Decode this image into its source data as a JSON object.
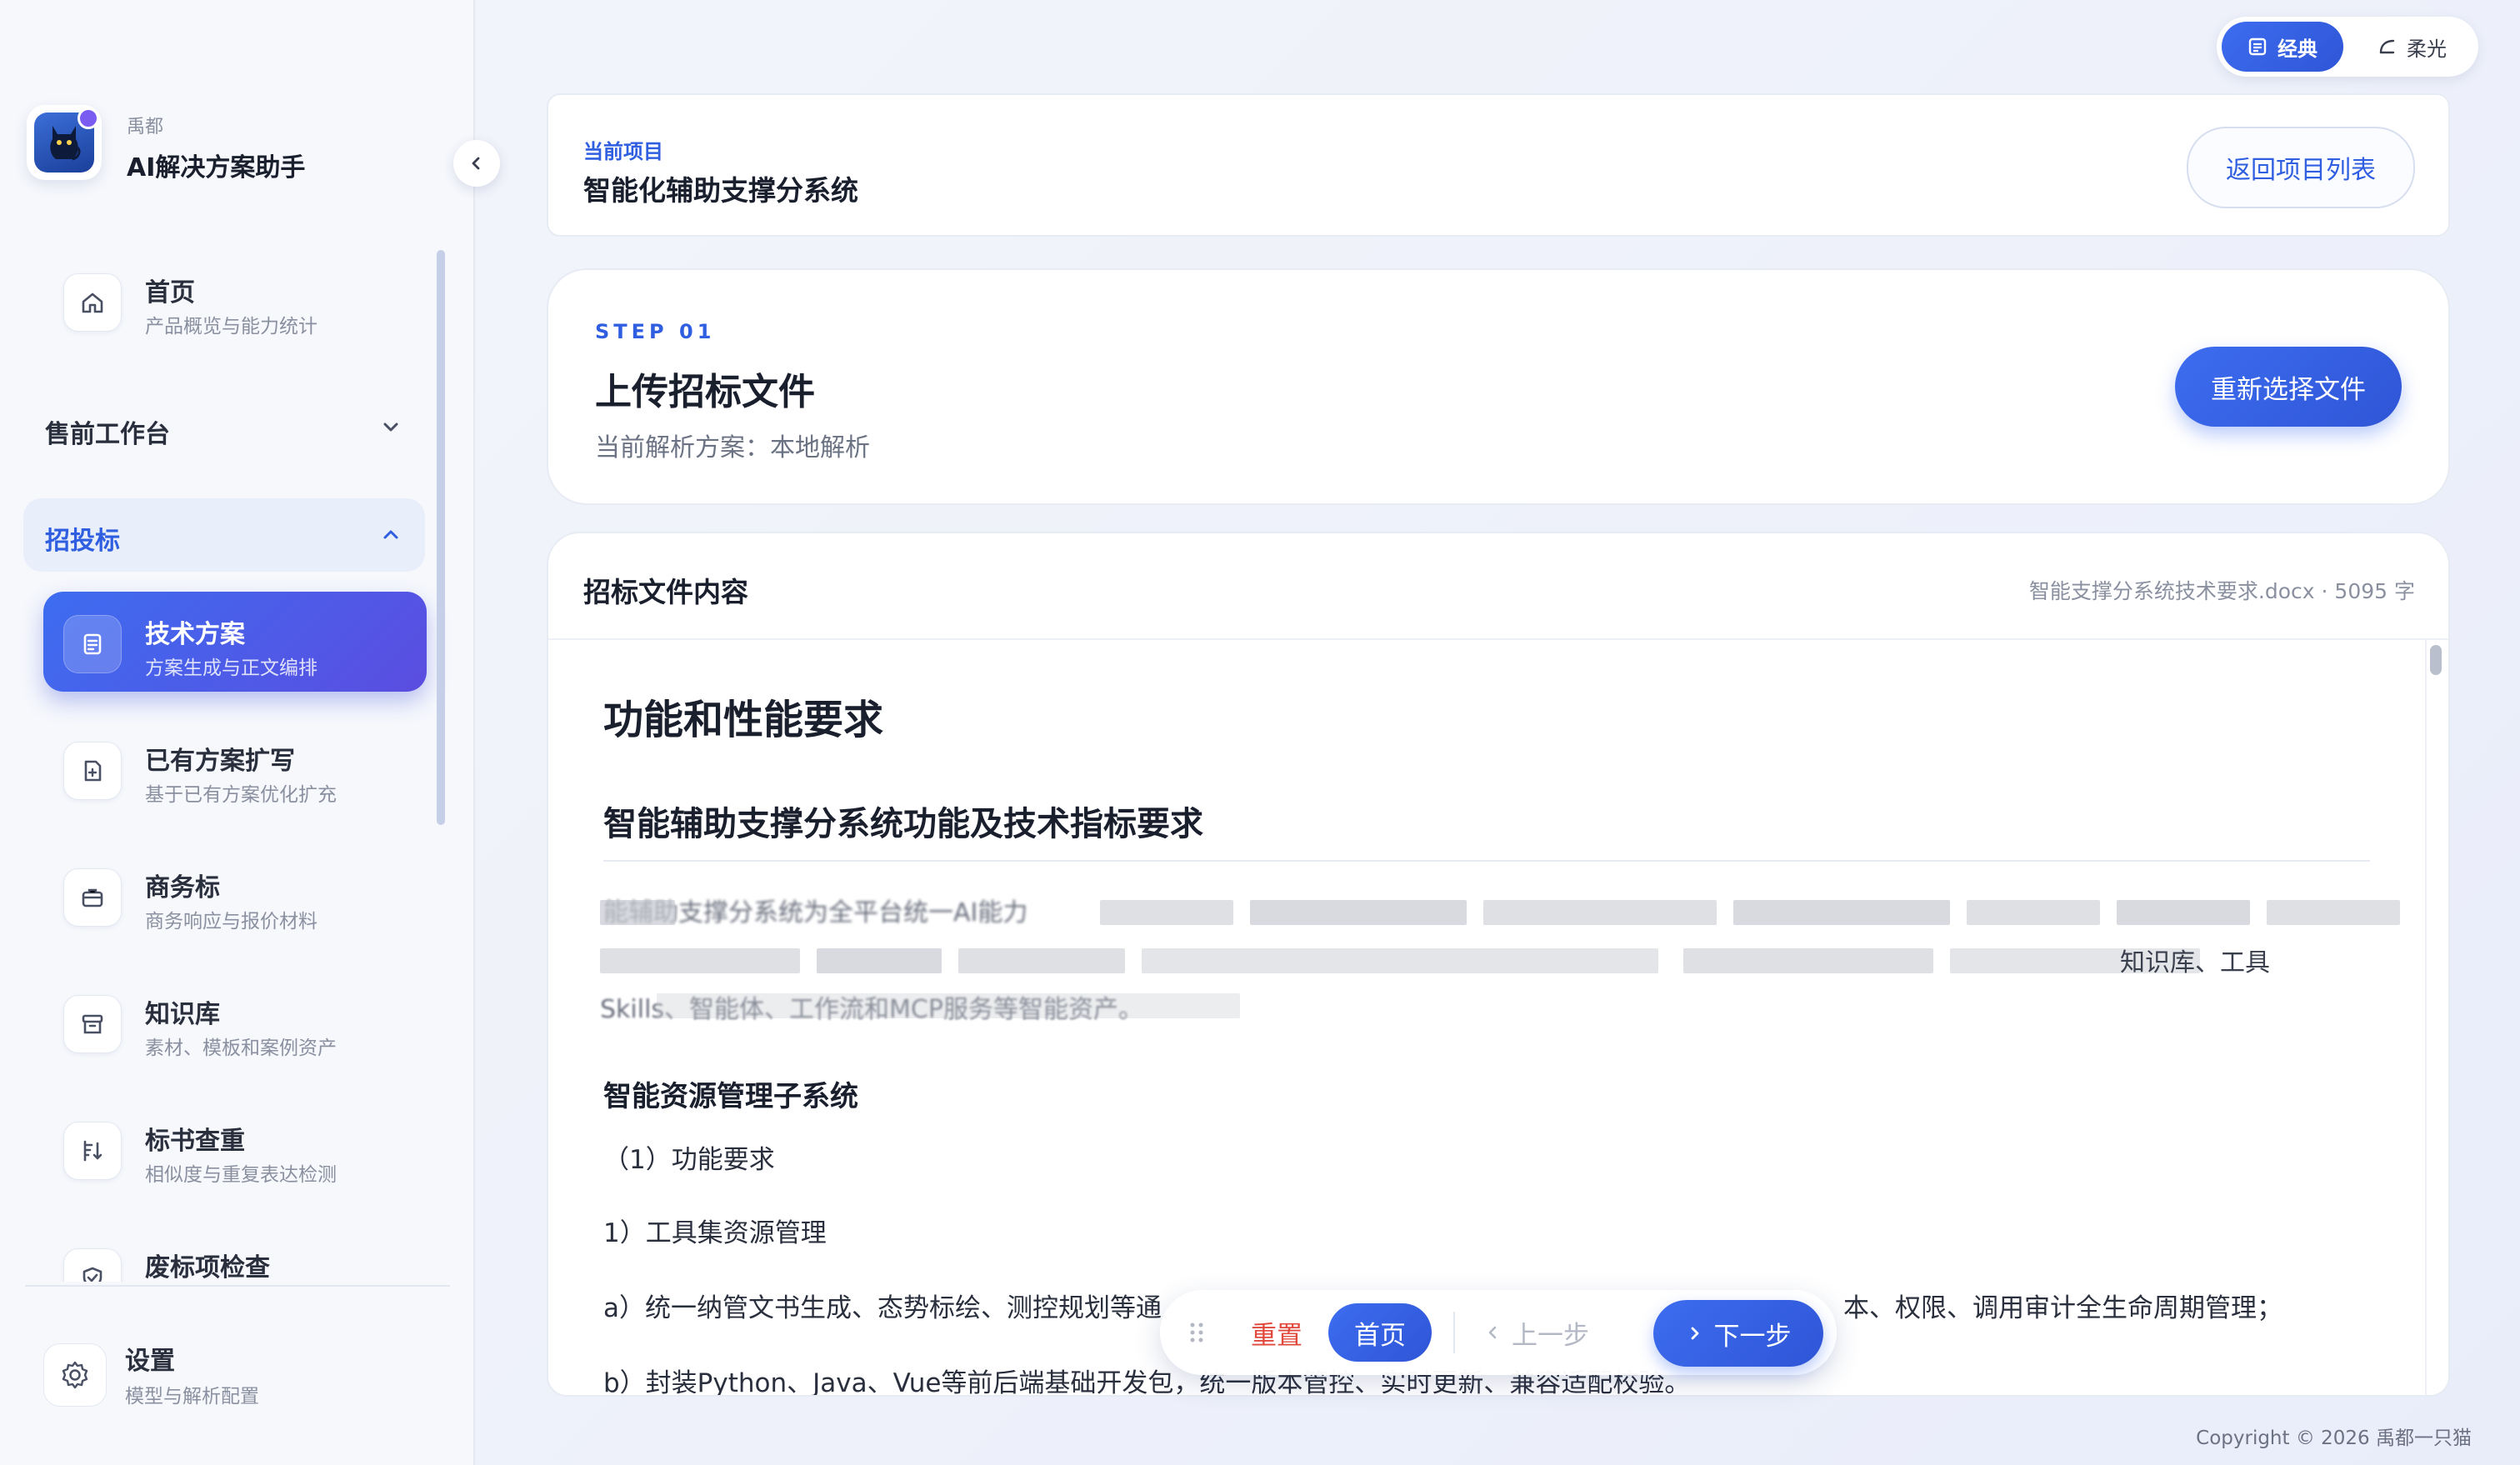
{
  "sidebar": {
    "brand_sub": "禹都",
    "brand_title": "AI解决方案助手",
    "home": {
      "title": "首页",
      "sub": "产品概览与能力统计"
    },
    "group_presale": "售前工作台",
    "group_bidding": "招投标",
    "items": [
      {
        "title": "技术方案",
        "sub": "方案生成与正文编排",
        "active": true
      },
      {
        "title": "已有方案扩写",
        "sub": "基于已有方案优化扩充"
      },
      {
        "title": "商务标",
        "sub": "商务响应与报价材料"
      },
      {
        "title": "知识库",
        "sub": "素材、模板和案例资产"
      },
      {
        "title": "标书查重",
        "sub": "相似度与重复表达检测"
      },
      {
        "title": "废标项检查",
        "sub": ""
      }
    ],
    "settings": {
      "title": "设置",
      "sub": "模型与解析配置"
    }
  },
  "theme": {
    "classic": "经典",
    "soft": "柔光"
  },
  "project": {
    "label": "当前项目",
    "name": "智能化辅助支撑分系统",
    "back_button": "返回项目列表"
  },
  "step": {
    "number": "STEP 01",
    "title": "上传招标文件",
    "subtitle": "当前解析方案：本地解析",
    "reselect_button": "重新选择文件"
  },
  "document": {
    "header_title": "招标文件内容",
    "meta": "智能支撑分系统技术要求.docx · 5095 字",
    "h1": "功能和性能要求",
    "h2": "智能辅助支撑分系统功能及技术指标要求",
    "blur_frag_1": "能辅助支撑分系统为全平台统一AI能力",
    "blur_frag_2": "知识库、工具",
    "blur_frag_3": "Skills、智能体、工作流和MCP服务等智能资产。",
    "h3": "智能资源管理子系统",
    "p1": "（1）功能要求",
    "p2": "1）工具集资源管理",
    "p3_left": "a）统一纳管文书生成、态势标绘、测控规划等通",
    "p3_right": "本、权限、调用审计全生命周期管理；",
    "p4": "b）封装Python、Java、Vue等前后端基础开发包，统一版本管控、实时更新、兼容适配校验。"
  },
  "bottom_bar": {
    "reset": "重置",
    "home": "首页",
    "prev": "上一步",
    "next": "下一步"
  },
  "footer": {
    "copyright": "Copyright © 2026 禹都一只猫"
  },
  "colors": {
    "accent": "#3d6df0",
    "accent_purple": "#5b4de0",
    "danger": "#e0493c"
  }
}
